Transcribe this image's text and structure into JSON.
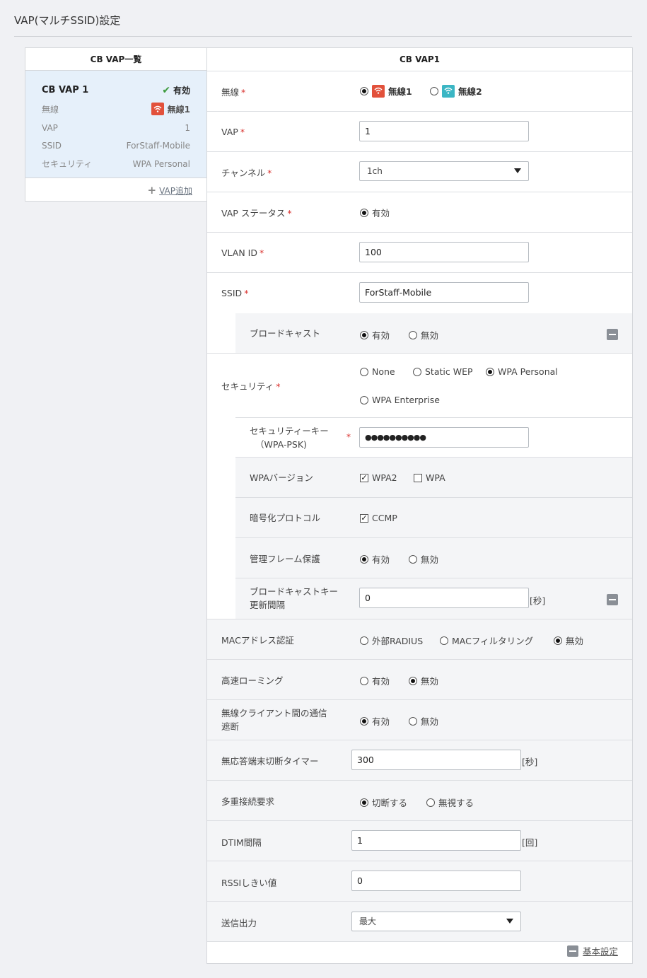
{
  "page": {
    "title": "VAP(マルチSSID)設定"
  },
  "left": {
    "header": "CB VAP一覧",
    "card": {
      "name": "CB VAP 1",
      "status": "有効",
      "rows": [
        {
          "label": "無線",
          "value": "無線1"
        },
        {
          "label": "VAP",
          "value": "1"
        },
        {
          "label": "SSID",
          "value": "ForStaff-Mobile"
        },
        {
          "label": "セキュリティ",
          "value": "WPA Personal"
        }
      ]
    },
    "add_label": "VAP追加"
  },
  "right": {
    "header": "CB VAP1",
    "required_mark": "*",
    "musen": {
      "label": "無線",
      "options": [
        "無線1",
        "無線2"
      ],
      "selected": 0
    },
    "vap": {
      "label": "VAP",
      "value": "1"
    },
    "channel": {
      "label": "チャンネル",
      "value": "1ch"
    },
    "vap_status": {
      "label": "VAP ステータス",
      "option": "有効"
    },
    "vlan": {
      "label": "VLAN ID",
      "value": "100"
    },
    "ssid": {
      "label": "SSID",
      "value": "ForStaff-Mobile"
    },
    "broadcast": {
      "label": "ブロードキャスト",
      "options": [
        "有効",
        "無効"
      ],
      "selected": 0
    },
    "security": {
      "label": "セキュリティ",
      "options": [
        "None",
        "Static WEP",
        "WPA Personal",
        "WPA Enterprise"
      ],
      "selected": 2
    },
    "sec_key": {
      "label_line1": "セキュリティーキー",
      "label_line2": "（WPA-PSK)",
      "value": "●●●●●●●●●●"
    },
    "wpa_version": {
      "label": "WPAバージョン",
      "options": [
        "WPA2",
        "WPA"
      ],
      "checked": [
        true,
        false
      ]
    },
    "encryption": {
      "label": "暗号化プロトコル",
      "option": "CCMP",
      "checked": true
    },
    "mgmt_frame": {
      "label": "管理フレーム保護",
      "options": [
        "有効",
        "無効"
      ],
      "selected": 0
    },
    "bcast_key": {
      "label_line1": "ブロードキャストキー",
      "label_line2": "更新間隔",
      "value": "0",
      "unit": "[秒]"
    },
    "mac_auth": {
      "label": "MACアドレス認証",
      "options": [
        "外部RADIUS",
        "MACフィルタリング",
        "無効"
      ],
      "selected": 2
    },
    "fast_roaming": {
      "label": "高速ローミング",
      "options": [
        "有効",
        "無効"
      ],
      "selected": 1
    },
    "client_block": {
      "label_line1": "無線クライアント間の通信",
      "label_line2": "遮断",
      "options": [
        "有効",
        "無効"
      ],
      "selected": 0
    },
    "no_resp_timer": {
      "label": "無応答端末切断タイマー",
      "value": "300",
      "unit": "[秒]"
    },
    "multi_conn": {
      "label": "多重接続要求",
      "options": [
        "切断する",
        "無視する"
      ],
      "selected": 0
    },
    "dtim": {
      "label": "DTIM間隔",
      "value": "1",
      "unit": "[回]"
    },
    "rssi": {
      "label": "RSSIしきい値",
      "value": "0"
    },
    "tx_power": {
      "label": "送信出力",
      "value": "最大"
    },
    "basic_label": "基本設定"
  },
  "colors": {
    "required": "#d9302c",
    "wifi1": "#e2513b",
    "wifi2": "#3bb6c4",
    "check": "#3c9a3c",
    "selected_card": "#e6f0fa"
  }
}
